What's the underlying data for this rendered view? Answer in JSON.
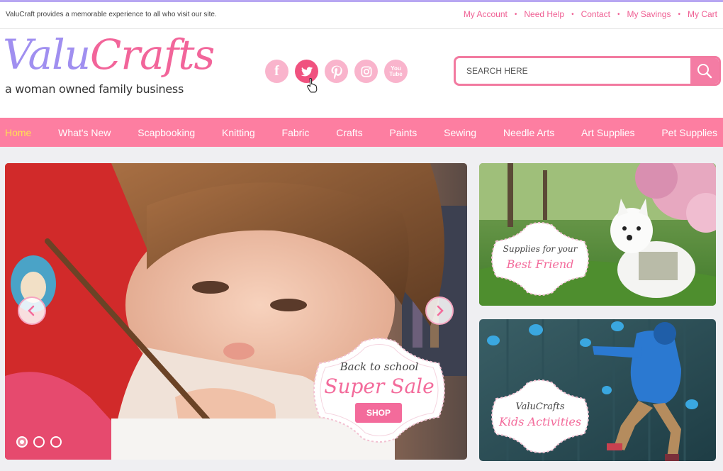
{
  "topbar": {
    "tagline": "ValuCraft provides a memorable experience to all who visit our site.",
    "links": [
      "My Account",
      "Need Help",
      "Contact",
      "My Savings",
      "My Cart"
    ],
    "separator": "•"
  },
  "logo": {
    "part1": "Valu",
    "part2": "Crafts",
    "subtitle": "a woman owned family business"
  },
  "social": [
    {
      "name": "facebook-icon",
      "glyph": "f"
    },
    {
      "name": "twitter-icon",
      "glyph": ""
    },
    {
      "name": "pinterest-icon",
      "glyph": ""
    },
    {
      "name": "instagram-icon",
      "glyph": ""
    },
    {
      "name": "youtube-icon",
      "glyph": "You Tube"
    }
  ],
  "search": {
    "placeholder": "SEARCH HERE"
  },
  "nav": {
    "items": [
      "Home",
      "What's New",
      "Scapbooking",
      "Knitting",
      "Fabric",
      "Crafts",
      "Paints",
      "Sewing",
      "Needle Arts",
      "Art Supplies",
      "Pet Supplies"
    ],
    "active": "Home"
  },
  "hero": {
    "line1": "Back to school",
    "line2": "Super Sale",
    "button": "SHOP"
  },
  "promo1": {
    "line1": "Supplies for your",
    "line2": "Best Friend"
  },
  "promo2": {
    "line1": "ValuCrafts",
    "line2": "Kids Activities"
  },
  "colors": {
    "brand_pink": "#fd7ea1",
    "brand_purple": "#a08ff0",
    "active_nav": "#ffe052"
  }
}
